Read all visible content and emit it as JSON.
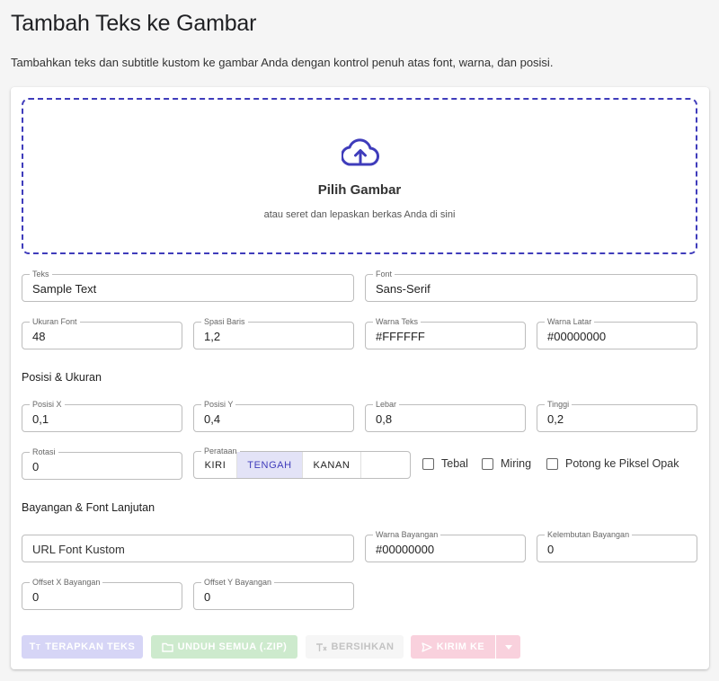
{
  "page": {
    "title": "Tambah Teks ke Gambar",
    "description": "Tambahkan teks dan subtitle kustom ke gambar Anda dengan kontrol penuh atas font, warna, dan posisi."
  },
  "dropzone": {
    "title": "Pilih Gambar",
    "subtitle": "atau seret dan lepaskan berkas Anda di sini"
  },
  "fields": {
    "text": {
      "label": "Teks",
      "value": "Sample Text"
    },
    "font": {
      "label": "Font",
      "value": "Sans-Serif"
    },
    "font_size": {
      "label": "Ukuran Font",
      "value": "48"
    },
    "line_spacing": {
      "label": "Spasi Baris",
      "value": "1,2"
    },
    "text_color": {
      "label": "Warna Teks",
      "value": "#FFFFFF"
    },
    "bg_color": {
      "label": "Warna Latar",
      "value": "#00000000"
    },
    "pos_x": {
      "label": "Posisi X",
      "value": "0,1"
    },
    "pos_y": {
      "label": "Posisi Y",
      "value": "0,4"
    },
    "width": {
      "label": "Lebar",
      "value": "0,8"
    },
    "height": {
      "label": "Tinggi",
      "value": "0,2"
    },
    "rotation": {
      "label": "Rotasi",
      "value": "0"
    },
    "custom_font_url": {
      "placeholder": "URL Font Kustom"
    },
    "shadow_color": {
      "label": "Warna Bayangan",
      "value": "#00000000"
    },
    "shadow_softness": {
      "label": "Kelembutan Bayangan",
      "value": "0"
    },
    "shadow_offset_x": {
      "label": "Offset X Bayangan",
      "value": "0"
    },
    "shadow_offset_y": {
      "label": "Offset Y Bayangan",
      "value": "0"
    }
  },
  "sections": {
    "position_size": "Posisi & Ukuran",
    "shadow_advanced": "Bayangan & Font Lanjutan"
  },
  "alignment": {
    "label": "Perataan",
    "options": [
      "KIRI",
      "TENGAH",
      "KANAN"
    ],
    "selected": "TENGAH"
  },
  "checkboxes": {
    "bold": "Tebal",
    "italic": "Miring",
    "crop": "Potong ke Piksel Opak"
  },
  "buttons": {
    "apply": "TERAPKAN TEKS",
    "download_all": "UNDUH SEMUA (.ZIP)",
    "clear": "BERSIHKAN",
    "send_to": "KIRIM KE"
  },
  "colors": {
    "accent": "#3f3cbb",
    "apply_disabled": "#d6d5f6",
    "download_disabled": "#cdeacd",
    "send_disabled": "#f9d1dd"
  },
  "icons": {
    "upload": "cloud-upload-icon",
    "apply": "text-format-icon",
    "download": "folder-icon",
    "clear": "clear-format-icon",
    "send": "send-icon",
    "dropdown": "chevron-down-icon"
  }
}
